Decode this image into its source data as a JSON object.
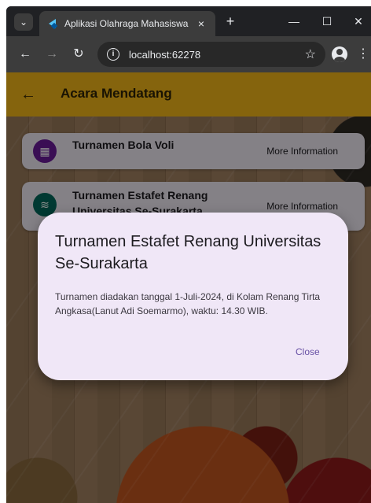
{
  "browser": {
    "tab_title": "Aplikasi Olahraga Mahasiswa",
    "tab_close_glyph": "×",
    "new_tab_glyph": "+",
    "url": "localhost:62278",
    "icons": [
      "tab-search-icon",
      "flutter-favicon-icon",
      "back-icon",
      "forward-icon",
      "reload-icon",
      "info-icon",
      "star-icon",
      "profile-icon",
      "menu-icon",
      "minimize-icon",
      "maximize-icon",
      "close-icon"
    ]
  },
  "app": {
    "title": "Acara Mendatang",
    "appbar_color": "#f3b619",
    "events": [
      {
        "title": "Turnamen Bola Voli",
        "more": "More Information",
        "icon": "calendar-icon",
        "icon_color": "#6a1b9a"
      },
      {
        "title": "Turnamen Estafet Renang Universitas Se-Surakarta",
        "more": "More Information",
        "icon": "swimming-icon",
        "icon_color": "#00695c"
      }
    ]
  },
  "dialog": {
    "title": "Turnamen Estafet Renang Universitas Se-Surakarta",
    "body": "Turnamen diadakan tanggal 1-Juli-2024, di Kolam Renang Tirta Angkasa(Lanut Adi Soemarmo), waktu: 14.30 WIB.",
    "close_label": "Close",
    "accent": "#6750a4"
  }
}
